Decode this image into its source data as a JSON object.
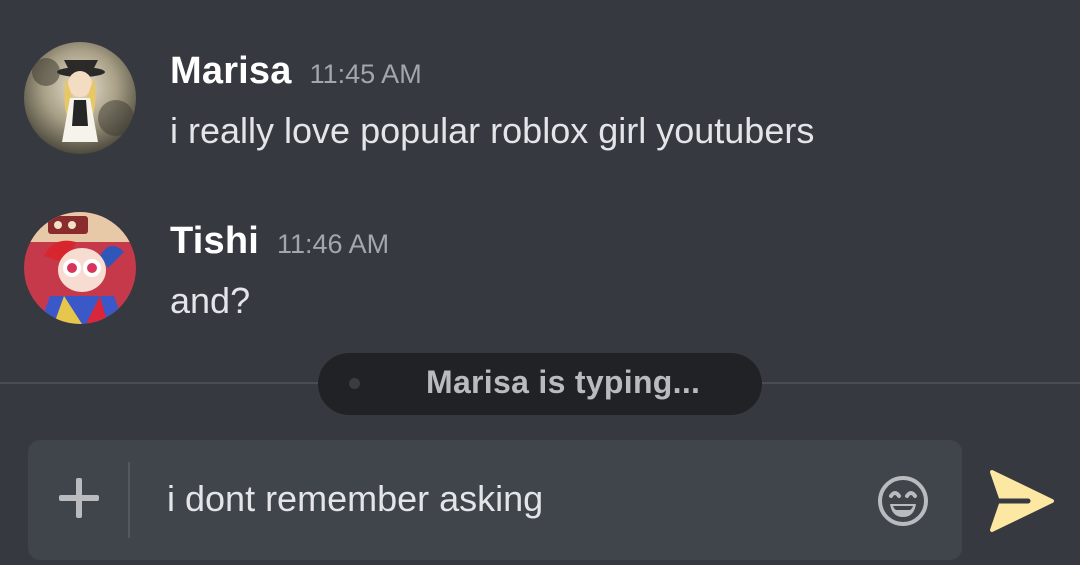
{
  "messages": [
    {
      "author": "Marisa",
      "time": "11:45 AM",
      "text": "i really love popular roblox girl youtubers",
      "avatar_icon": "user-avatar-marisa"
    },
    {
      "author": "Tishi",
      "time": "11:46 AM",
      "text": "and?",
      "avatar_icon": "user-avatar-tishi"
    }
  ],
  "typing_indicator": {
    "text": "Marisa is typing..."
  },
  "composer": {
    "value": "i dont remember asking",
    "attach_icon": "plus-icon",
    "emoji_icon": "emoji-smile-icon",
    "send_icon": "send-arrow-icon"
  },
  "colors": {
    "background": "#36393f",
    "composer_bg": "#40444b",
    "typing_pill_bg": "#202225",
    "username": "#ffffff",
    "timestamp": "#a3a6aa",
    "send_accent": "#fce7a3"
  }
}
